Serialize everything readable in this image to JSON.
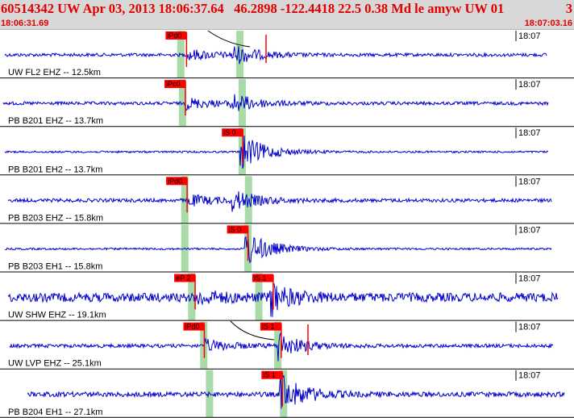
{
  "header": {
    "title": "60514342 UW Apr 03, 2013 18:06:37.64   46.2898 -122.4418 22.5 0.38 Md le amyw UW 01",
    "count": "3",
    "start_time": "18:06:31.69",
    "end_time": "18:07:03.16"
  },
  "colors": {
    "trace": "#0000cc",
    "pick": "#ff0000",
    "window": "#a8dba8",
    "header_bg": "#d8d8d8",
    "header_text": "#e00000"
  },
  "channels": [
    {
      "label": "UW FL2 EHZ -- 12.5km",
      "time_label": "18:07",
      "picks": [
        {
          "label": "iPd0",
          "pos": 0.325
        }
      ],
      "windows": [
        0.315,
        0.418
      ]
    },
    {
      "label": "PB B201 EHZ -- 13.7km",
      "time_label": "18:07",
      "picks": [
        {
          "label": "iPc0",
          "pos": 0.323
        }
      ],
      "windows": [
        0.318,
        0.422
      ]
    },
    {
      "label": "PB B201 EH2 -- 13.7km",
      "time_label": "18:07",
      "picks": [
        {
          "label": "iS 0",
          "pos": 0.423
        }
      ],
      "windows": [
        0.422
      ]
    },
    {
      "label": "PB B203 EHZ -- 15.8km",
      "time_label": "18:07",
      "picks": [
        {
          "label": "iPd0",
          "pos": 0.326
        }
      ],
      "windows": [
        0.322,
        0.433
      ]
    },
    {
      "label": "PB B203 EH1 -- 15.8km",
      "time_label": "18:07",
      "picks": [
        {
          "label": "iS 0",
          "pos": 0.432
        }
      ],
      "windows": [
        0.322,
        0.432
      ]
    },
    {
      "label": "UW SHW EHZ -- 19.1km",
      "time_label": "18:07",
      "picks": [
        {
          "label": "eP 2",
          "pos": 0.34
        },
        {
          "label": "iS 1",
          "pos": 0.476
        }
      ],
      "windows": [
        0.334,
        0.451
      ]
    },
    {
      "label": "UW LVP EHZ -- 25.1km",
      "time_label": "18:07",
      "picks": [
        {
          "label": "iPd0",
          "pos": 0.356
        },
        {
          "label": "iS 1",
          "pos": 0.49
        }
      ],
      "windows": [
        0.355,
        0.484
      ]
    },
    {
      "label": "PB B204 EH1 -- 27.1km",
      "time_label": "18:07",
      "picks": [
        {
          "label": "iS 1",
          "pos": 0.492
        }
      ],
      "windows": [
        0.365,
        0.494
      ]
    }
  ]
}
